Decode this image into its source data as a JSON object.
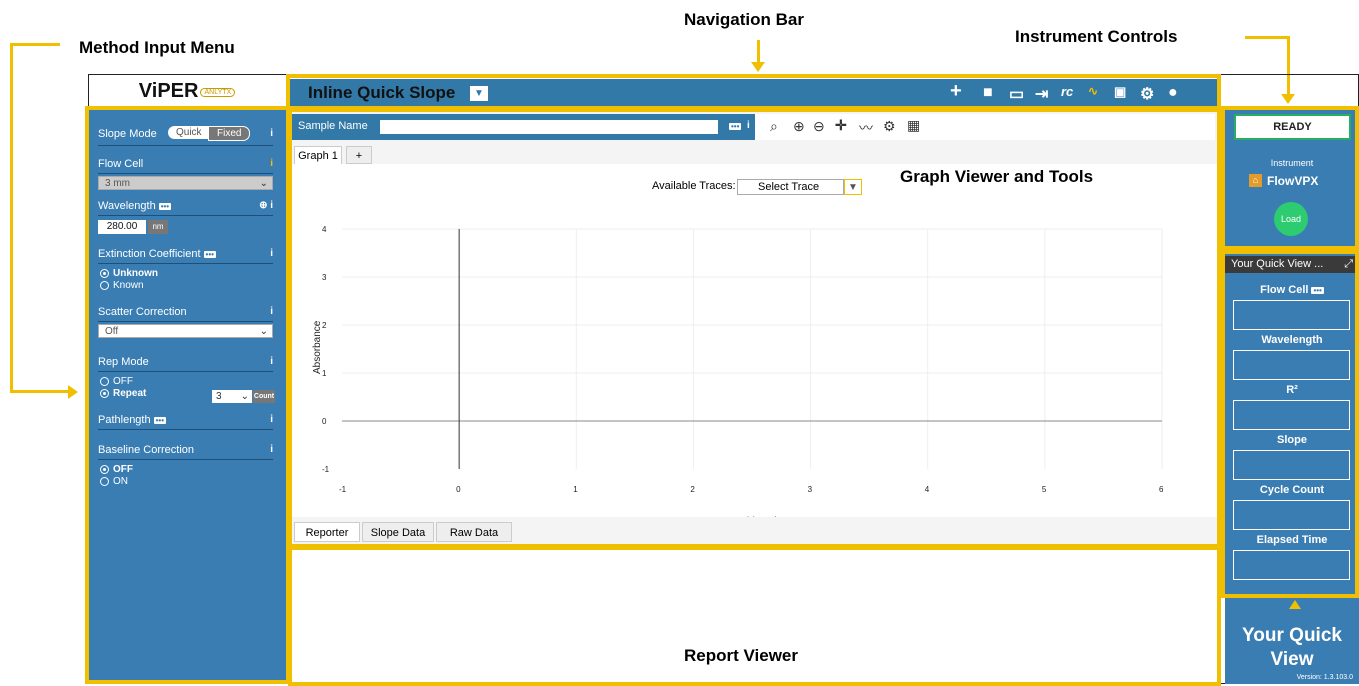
{
  "annotations": {
    "navigation_bar": "Navigation Bar",
    "method_input_menu": "Method Input Menu",
    "instrument_controls": "Instrument Controls",
    "graph_viewer_tools": "Graph Viewer and Tools",
    "report_viewer": "Report Viewer",
    "your_quick_view": "Your Quick View"
  },
  "logo": {
    "text": "ViPER",
    "sub": "ANLYTX"
  },
  "nav": {
    "title": "Inline Quick Slope",
    "icons": [
      "plus-icon",
      "folder-icon",
      "save-icon",
      "export-icon",
      "rc-icon",
      "chart-icon",
      "help-icon",
      "settings-icon",
      "user-icon"
    ]
  },
  "left": {
    "slope_mode": "Slope Mode",
    "quick": "Quick",
    "fixed": "Fixed",
    "flow_cell": "Flow Cell",
    "flow_cell_value": "3 mm",
    "wavelength": "Wavelength",
    "wavelength_value": "280.00",
    "wavelength_unit": "nm",
    "extinction": "Extinction Coefficient",
    "unknown": "Unknown",
    "known": "Known",
    "scatter": "Scatter Correction",
    "scatter_value": "Off",
    "rep_mode": "Rep Mode",
    "off": "OFF",
    "repeat": "Repeat",
    "repeat_count": "3",
    "count": "Count",
    "pathlength": "Pathlength",
    "baseline": "Baseline Correction",
    "baseline_off": "OFF",
    "baseline_on": "ON",
    "info": "i"
  },
  "graph": {
    "sample_name_label": "Sample Name",
    "tab1": "Graph 1",
    "tab_add": "+",
    "available_traces": "Available Traces:",
    "select_trace": "Select Trace",
    "bottom_tabs": [
      "Reporter",
      "Slope Data",
      "Raw Data"
    ]
  },
  "chart_data": {
    "type": "line",
    "xlabel": "Pathlength",
    "ylabel": "Absorbance",
    "xlim": [
      -1,
      6
    ],
    "ylim": [
      -1,
      4
    ],
    "xticks": [
      "-1",
      "0",
      "1",
      "2",
      "3",
      "4",
      "5",
      "6"
    ],
    "yticks": [
      "4",
      "3",
      "2",
      "1",
      "0",
      "-1"
    ],
    "series": []
  },
  "right": {
    "status": "READY",
    "instrument_label": "Instrument",
    "instrument_name": "FlowVPX",
    "load": "Load",
    "quick_view_title": "Your Quick View ...",
    "fields": [
      "Flow Cell",
      "Wavelength",
      "R²",
      "Slope",
      "Cycle Count",
      "Elapsed Time"
    ],
    "version": "Version: 1.3.103.0"
  }
}
